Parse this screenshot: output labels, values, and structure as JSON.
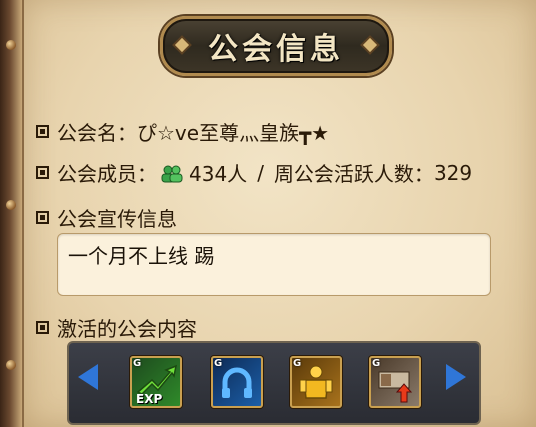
{
  "title": "公会信息",
  "guild_name": {
    "label": "公会名：",
    "value": "ぴ☆ve至尊灬皇族┳★"
  },
  "members": {
    "label": "公会成员：",
    "count": "434人",
    "separator": "/",
    "weekly_active_label": "周公会活跃人数：",
    "weekly_active_value": "329"
  },
  "announcement": {
    "label": "公会宣传信息",
    "text": "一个月不上线  踢"
  },
  "activated": {
    "label": "激活的公会内容",
    "items": [
      {
        "icon": "exp-boost-icon",
        "badge": "G",
        "caption": "EXP"
      },
      {
        "icon": "headset-icon",
        "badge": "G",
        "caption": ""
      },
      {
        "icon": "golden-armor-icon",
        "badge": "G",
        "caption": ""
      },
      {
        "icon": "upgrade-icon",
        "badge": "G",
        "caption": ""
      }
    ]
  },
  "colors": {
    "accent_blue": "#2f76d8",
    "text": "#2a1a08",
    "gold": "#c9a050"
  }
}
